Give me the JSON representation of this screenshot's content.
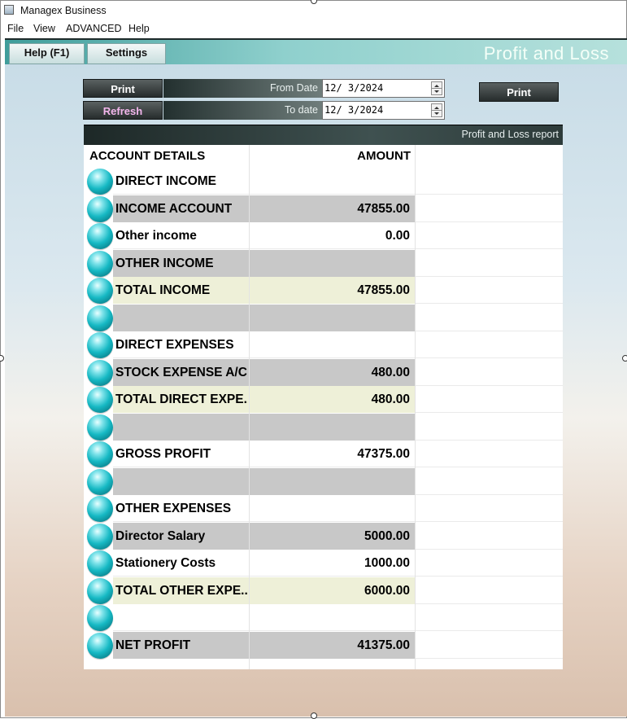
{
  "window": {
    "title": "Managex Business"
  },
  "menu": [
    "File",
    "View",
    "ADVANCED",
    "Help"
  ],
  "toolbar": {
    "help_label": "Help (F1)",
    "settings_label": "Settings",
    "page_title": "Profit and Loss"
  },
  "filters": {
    "print_label": "Print",
    "refresh_label": "Refresh",
    "from_label": "From Date",
    "to_label": "To date",
    "from_value": "12/ 3/2024",
    "to_value": "12/ 3/2024",
    "print2_label": "Print"
  },
  "report": {
    "title": "Profit and Loss report",
    "col_account": "ACCOUNT DETAILS",
    "col_amount": "AMOUNT",
    "rows": [
      {
        "label": "DIRECT INCOME",
        "amount": "",
        "style": "white"
      },
      {
        "label": "INCOME ACCOUNT",
        "amount": "47855.00",
        "style": "gray"
      },
      {
        "label": "Other income",
        "amount": "0.00",
        "style": "white"
      },
      {
        "label": "OTHER INCOME",
        "amount": "",
        "style": "gray"
      },
      {
        "label": "TOTAL INCOME",
        "amount": "47855.00",
        "style": "cream"
      },
      {
        "label": "",
        "amount": "",
        "style": "gray"
      },
      {
        "label": "DIRECT EXPENSES",
        "amount": "",
        "style": "white"
      },
      {
        "label": "STOCK EXPENSE A/C",
        "amount": "480.00",
        "style": "gray"
      },
      {
        "label": "TOTAL DIRECT EXPE...",
        "amount": "480.00",
        "style": "cream"
      },
      {
        "label": "",
        "amount": "",
        "style": "gray"
      },
      {
        "label": "GROSS PROFIT",
        "amount": "47375.00",
        "style": "white"
      },
      {
        "label": "",
        "amount": "",
        "style": "gray"
      },
      {
        "label": "OTHER EXPENSES",
        "amount": "",
        "style": "white"
      },
      {
        "label": "Director Salary",
        "amount": "5000.00",
        "style": "gray"
      },
      {
        "label": "Stationery Costs",
        "amount": "1000.00",
        "style": "white"
      },
      {
        "label": "TOTAL OTHER EXPE...",
        "amount": "6000.00",
        "style": "cream"
      },
      {
        "label": "",
        "amount": "",
        "style": "white"
      },
      {
        "label": "NET PROFIT",
        "amount": "41375.00",
        "style": "gray"
      }
    ]
  }
}
